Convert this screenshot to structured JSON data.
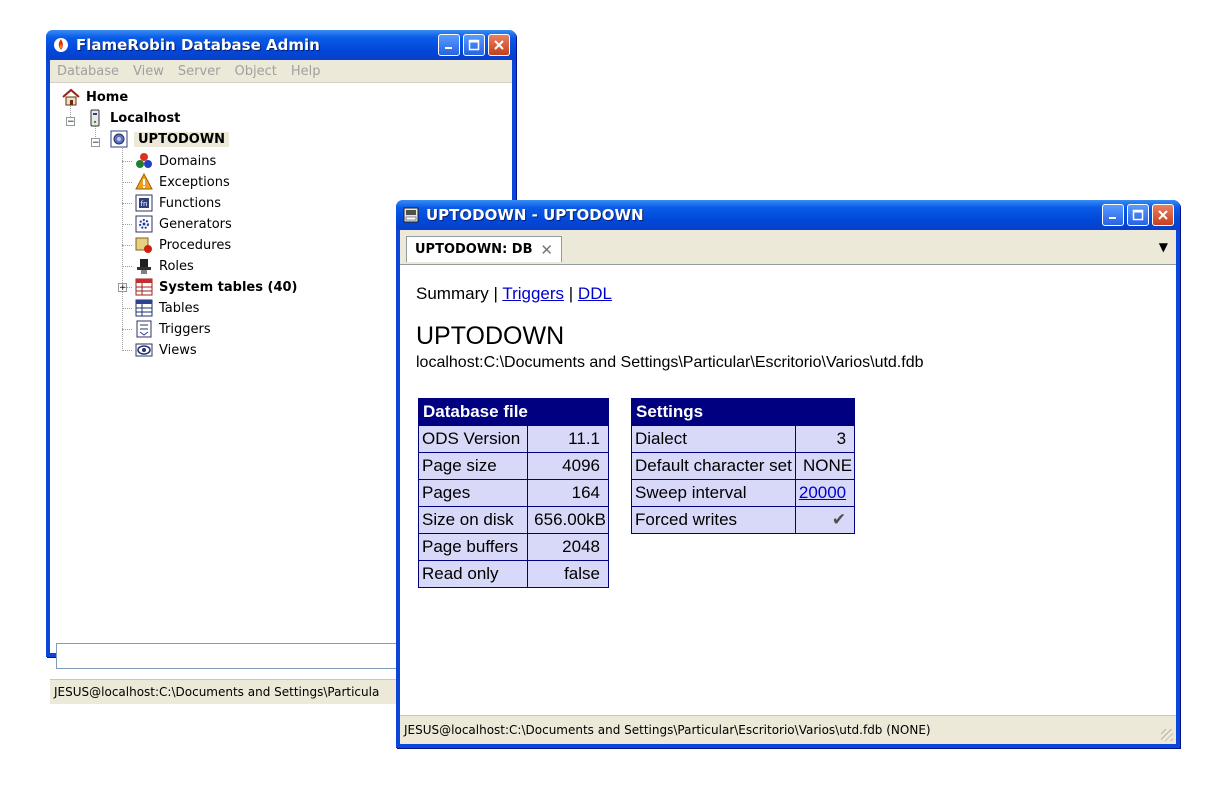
{
  "main_window": {
    "title": "FlameRobin Database Admin",
    "menu": [
      "Database",
      "View",
      "Server",
      "Object",
      "Help"
    ],
    "tree": {
      "home": "Home",
      "server": "Localhost",
      "database": "UPTODOWN",
      "items": [
        "Domains",
        "Exceptions",
        "Functions",
        "Generators",
        "Procedures",
        "Roles",
        "System tables (40)",
        "Tables",
        "Triggers",
        "Views"
      ]
    },
    "status": "JESUS@localhost:C:\\Documents and Settings\\Particula"
  },
  "properties_window": {
    "title": "UPTODOWN - UPTODOWN",
    "tab_label": "UPTODOWN: DB",
    "nav": {
      "summary": "Summary",
      "sep": "|",
      "triggers": "Triggers",
      "ddl": "DDL"
    },
    "db_name": "UPTODOWN",
    "db_path": "localhost:C:\\Documents and Settings\\Particular\\Escritorio\\Varios\\utd.fdb",
    "database_file": {
      "header": "Database file",
      "rows": [
        {
          "label": "ODS Version",
          "value": "11.1"
        },
        {
          "label": "Page size",
          "value": "4096"
        },
        {
          "label": "Pages",
          "value": "164"
        },
        {
          "label": "Size on disk",
          "value": "656.00kB"
        },
        {
          "label": "Page buffers",
          "value": "2048"
        },
        {
          "label": "Read only",
          "value": "false"
        }
      ]
    },
    "settings": {
      "header": "Settings",
      "rows": [
        {
          "label": "Dialect",
          "value": "3"
        },
        {
          "label": "Default character set",
          "value": "NONE"
        },
        {
          "label": "Sweep interval",
          "value": "20000"
        },
        {
          "label": "Forced writes",
          "value": "✔"
        }
      ]
    },
    "status": "JESUS@localhost:C:\\Documents and Settings\\Particular\\Escritorio\\Varios\\utd.fdb (NONE)"
  }
}
